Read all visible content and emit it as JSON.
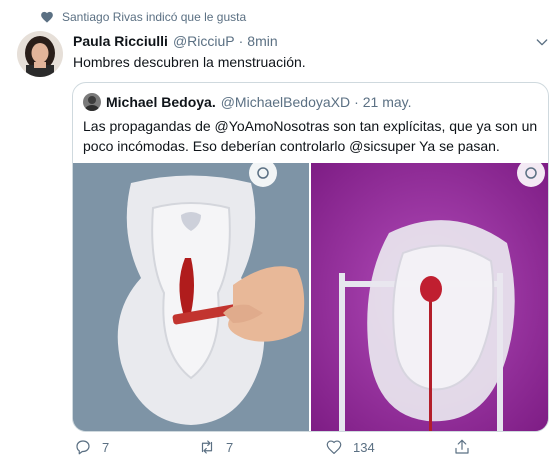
{
  "social_context": {
    "text": "Santiago Rivas indicó que le gusta",
    "icon": "heart-icon"
  },
  "tweet": {
    "author_name": "Paula Ricciulli",
    "author_handle": "@RicciuP",
    "separator": "·",
    "time": "8min",
    "text": "Hombres descubren la menstruación."
  },
  "quote": {
    "author_name": "Michael Bedoya.",
    "author_handle": "@MichaelBedoyaXD",
    "separator": "·",
    "time": "21 may.",
    "text": "Las propagandas de @YoAmoNosotras  son tan explícitas, que ya son un poco incómodas. Eso deberían controlarlo @sicsuper Ya se pasan."
  },
  "actions": {
    "reply_count": "7",
    "retweet_count": "7",
    "like_count": "134"
  },
  "colors": {
    "secondary_text": "#5b7083",
    "border": "#cfd9de",
    "text": "#0f1419"
  }
}
